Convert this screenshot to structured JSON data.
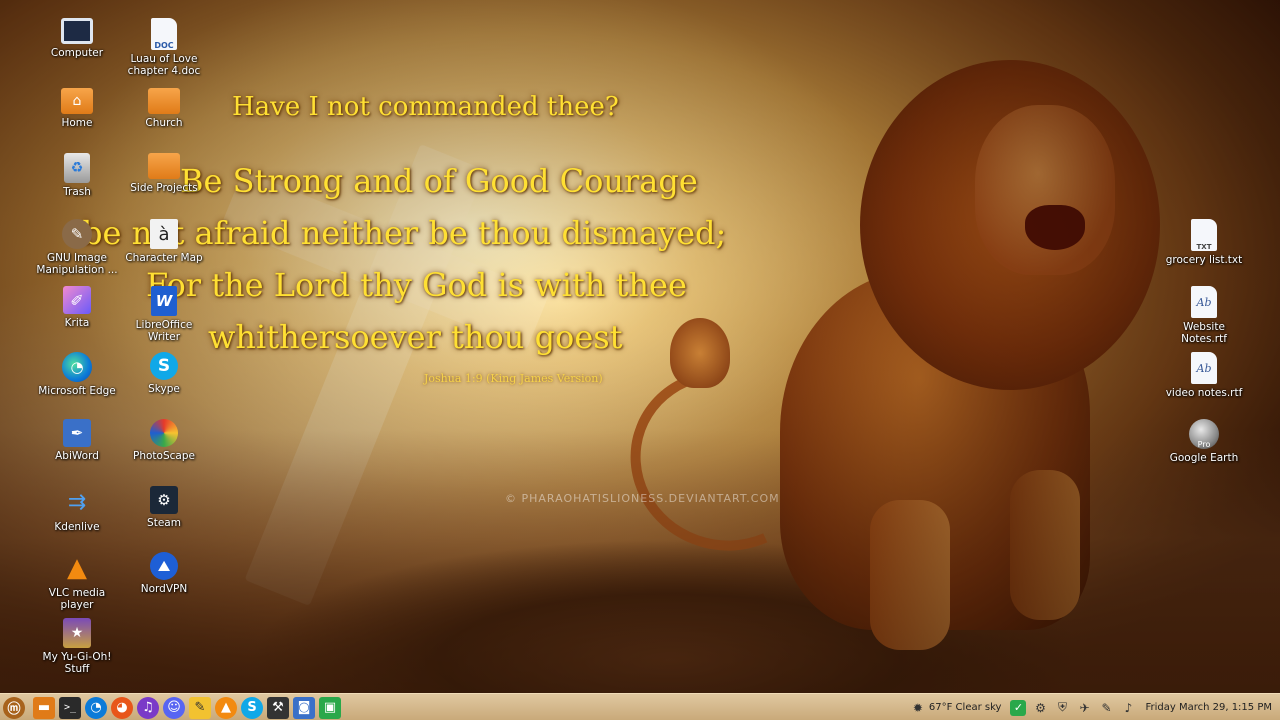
{
  "verse": {
    "line1": "Have I not commanded thee?",
    "line2": "Be Strong and of Good Courage",
    "line3": "be not afraid neither be thou dismayed;",
    "line4": "For the Lord thy God is with thee",
    "line5": "whithersoever thou goest",
    "reference": "Joshua 1:9 (King James Version)"
  },
  "watermark": "© PHARAOHATISLIONESS.DEVIANTART.COM",
  "desktop_icons_left_col1": [
    {
      "label": "Computer",
      "icon": "computer-icon"
    },
    {
      "label": "Home",
      "icon": "home-folder-icon"
    },
    {
      "label": "Trash",
      "icon": "trash-icon"
    },
    {
      "label": "GNU Image Manipulation ...",
      "icon": "gimp-icon"
    },
    {
      "label": "Krita",
      "icon": "krita-icon"
    },
    {
      "label": "Microsoft Edge",
      "icon": "edge-icon"
    },
    {
      "label": "AbiWord",
      "icon": "abiword-icon"
    },
    {
      "label": "Kdenlive",
      "icon": "kdenlive-icon"
    },
    {
      "label": "VLC media player",
      "icon": "vlc-icon"
    },
    {
      "label": "My Yu-Gi-Oh! Stuff",
      "icon": "yugioh-icon"
    }
  ],
  "desktop_icons_left_col2": [
    {
      "label": "Luau of Love chapter 4.doc",
      "icon": "doc-file-icon",
      "badge": "DOC"
    },
    {
      "label": "Church",
      "icon": "folder-icon"
    },
    {
      "label": "Side Projects",
      "icon": "folder-icon"
    },
    {
      "label": "Character Map",
      "icon": "character-map-icon",
      "glyph": "à"
    },
    {
      "label": "LibreOffice Writer",
      "icon": "libreoffice-writer-icon"
    },
    {
      "label": "Skype",
      "icon": "skype-icon"
    },
    {
      "label": "PhotoScape",
      "icon": "photoscape-icon"
    },
    {
      "label": "Steam",
      "icon": "steam-icon"
    },
    {
      "label": "NordVPN",
      "icon": "nordvpn-icon"
    }
  ],
  "desktop_icons_right": [
    {
      "label": "grocery list.txt",
      "icon": "txt-file-icon",
      "badge": "TXT"
    },
    {
      "label": "Website Notes.rtf",
      "icon": "rtf-file-icon",
      "badge": "Ab"
    },
    {
      "label": "video notes.rtf",
      "icon": "rtf-file-icon",
      "badge": "Ab"
    },
    {
      "label": "Google Earth",
      "icon": "google-earth-icon",
      "badge": "Pro"
    }
  ],
  "taskbar": {
    "apps": [
      "files-icon",
      "terminal-icon",
      "edge-icon",
      "firefox-icon",
      "podcast-icon",
      "discord-icon",
      "notes-icon",
      "vlc-icon",
      "skype-icon",
      "app-icon",
      "app-icon",
      "app-icon"
    ],
    "weather": "67°F Clear sky",
    "clock": "Friday March 29, 1:15 PM"
  },
  "colors": {
    "verse_text": "#ffe033",
    "taskbar": "#d8bc90",
    "menu_button": "#a8631c"
  }
}
